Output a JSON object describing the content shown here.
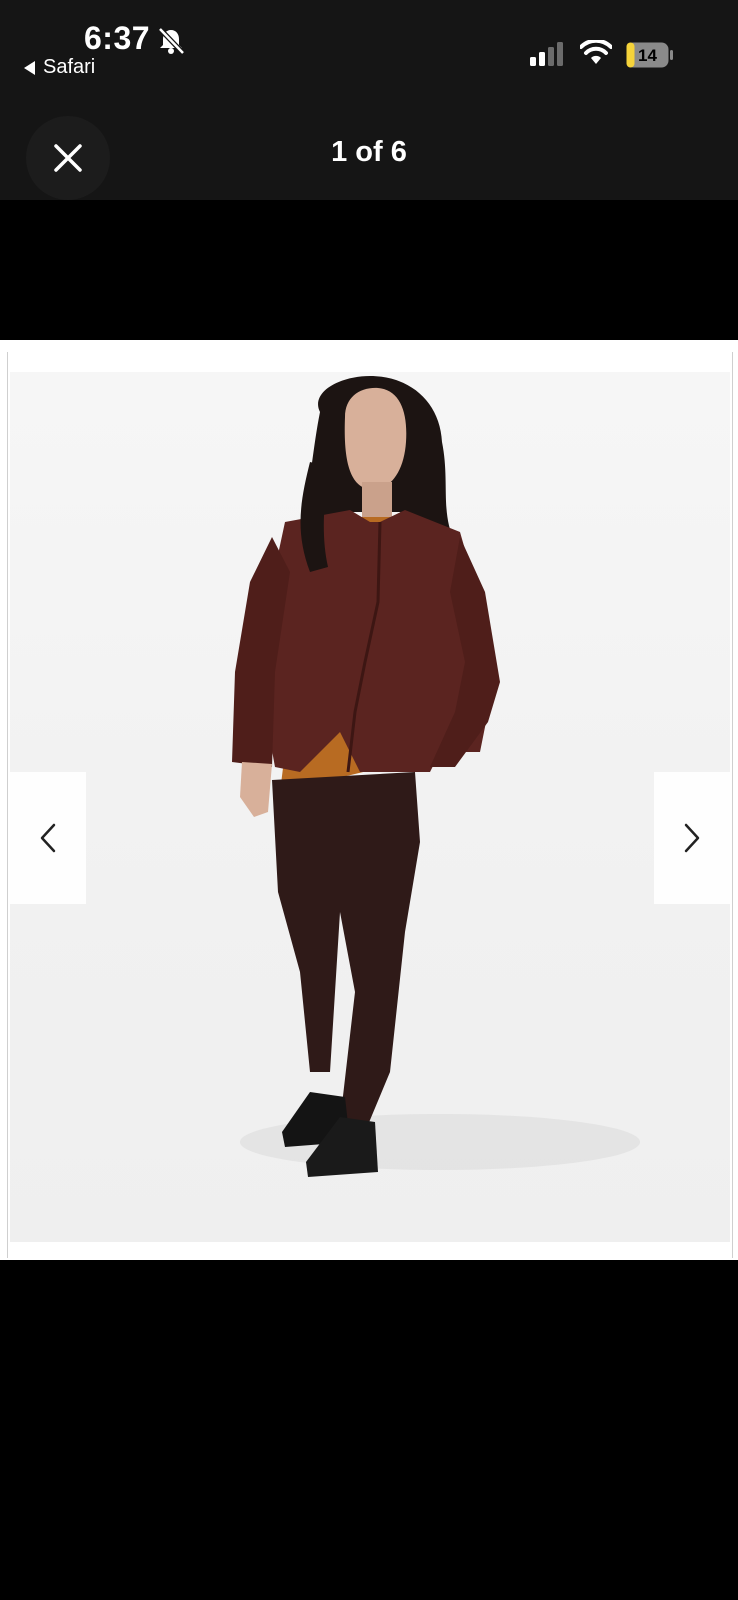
{
  "status_bar": {
    "time": "6:37",
    "back_app": "Safari",
    "battery": "14",
    "icons": [
      "bell-slash-icon",
      "cellular-signal-icon",
      "wifi-icon",
      "battery-icon"
    ]
  },
  "header": {
    "title": "1 of 6",
    "close_icon": "close-icon"
  },
  "gallery": {
    "current_index": 1,
    "total": 6,
    "prev_icon": "chevron-left-icon",
    "next_icon": "chevron-right-icon"
  },
  "colors": {
    "top_bar": "#151515",
    "battery_fill": "#f5d33a",
    "jacket": "#5b2420",
    "tshirt": "#b86b22",
    "pants": "#2f1a18"
  }
}
